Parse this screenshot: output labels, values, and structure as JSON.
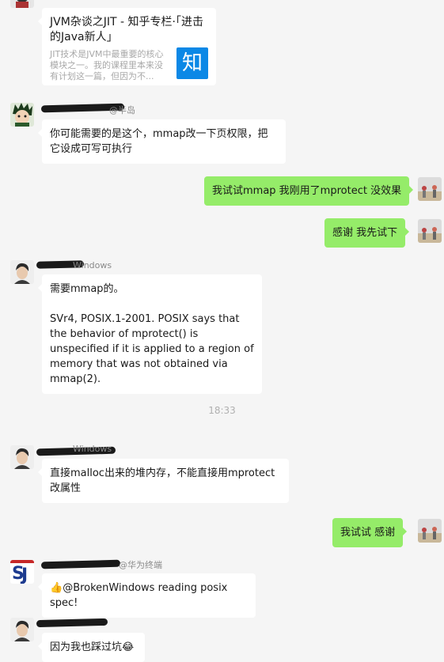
{
  "messages": [
    {
      "kind": "link_card",
      "title": "JVM杂谈之JIT - 知乎专栏·「进击的Java新人」",
      "desc": "JIT技术是JVM中最重要的核心模块之一。我的课程里本来没有计划这一篇，但因为不...",
      "icon_char": "知",
      "icon_name": "zhihu-icon"
    },
    {
      "kind": "incoming",
      "name_fragment": "@半岛",
      "text": "你可能需要的是这个，mmap改一下页权限，把它设成可写可执行"
    },
    {
      "kind": "outgoing",
      "text": "我试试mmap  我刚用了mprotect  没效果"
    },
    {
      "kind": "outgoing",
      "text": "感谢  我先试下"
    },
    {
      "kind": "incoming",
      "name_fragment": "Windows",
      "text_line1": "需要mmap的。",
      "text_line2": "SVr4, POSIX.1-2001. POSIX says that the behavior of mprotect() is unspecified if it is applied to a region of memory that was not obtained via mmap(2)."
    },
    {
      "kind": "time",
      "text": "18:33"
    },
    {
      "kind": "incoming",
      "name_fragment": "Windows",
      "text": "直接malloc出来的堆内存，不能直接用mprotect改属性"
    },
    {
      "kind": "outgoing",
      "text": "我试试   感谢"
    },
    {
      "kind": "incoming",
      "name_fragment": "@华为终端",
      "emoji": "👍",
      "text": "@BrokenWindows  reading posix spec!"
    },
    {
      "kind": "incoming",
      "name_fragment": "",
      "text": "因为我也踩过坑",
      "emoji": "😂"
    }
  ],
  "colors": {
    "background": "#f5f5f5",
    "incoming_bubble": "#ffffff",
    "outgoing_bubble": "#95ec69",
    "zhihu_blue": "#0b88e6"
  }
}
